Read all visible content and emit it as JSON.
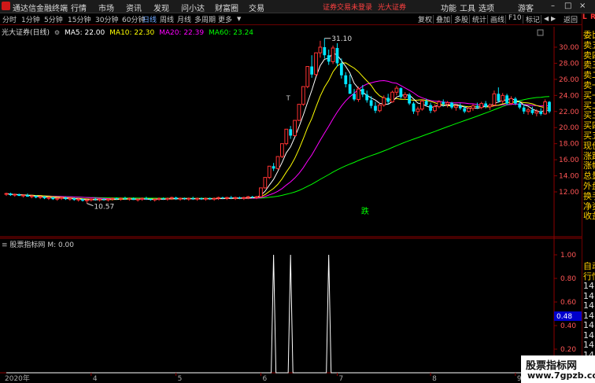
{
  "topbar": {
    "app_title": "通达信金融终端",
    "menu": [
      "行情",
      "市场",
      "资讯",
      "发现",
      "问小达",
      "财富圈",
      "交易"
    ],
    "notice": "证券交易未登录",
    "broker": "光大证券",
    "right_menu": [
      "功能",
      "工具",
      "选项",
      "游客"
    ],
    "window_controls": [
      "–",
      "□",
      "×"
    ]
  },
  "periodbar": {
    "periods": [
      "分时",
      "1分钟",
      "5分钟",
      "15分钟",
      "30分钟",
      "60分钟",
      "日线",
      "周线",
      "月线",
      "多周期",
      "更多"
    ],
    "active": "日线",
    "tools": [
      "复权",
      "叠加",
      "多股",
      "统计",
      "画线",
      "F10",
      "标记",
      "返回"
    ]
  },
  "chart": {
    "security": "光大证券(日线)",
    "ma": [
      {
        "label": "MA5: 22.00",
        "color": "#ffffff"
      },
      {
        "label": "MA10: 22.30",
        "color": "#ffff00"
      },
      {
        "label": "MA20: 22.39",
        "color": "#ff00ff"
      },
      {
        "label": "MA60: 23.24",
        "color": "#00ff00"
      }
    ],
    "y_ticks": [
      "30.00",
      "28.00",
      "26.00",
      "24.00",
      "22.00",
      "20.00",
      "18.00",
      "16.00",
      "14.00",
      "12.00"
    ],
    "high_label": "31.10",
    "low_label": "10.57",
    "t_marker": "T",
    "fall_marker": "跌",
    "sub_title": "股票指标网",
    "sub_value": "M: 0.00",
    "sub_y_ticks": [
      "1.00",
      "0.80",
      "0.60",
      "0.40",
      "0.20"
    ],
    "sub_current": "0.48",
    "x_labels": [
      "2020年",
      "4",
      "5",
      "6",
      "7",
      "8",
      "9"
    ]
  },
  "rightpanel": {
    "top_labels": [
      "L",
      "R"
    ],
    "quote_rows": [
      "委比",
      "卖五",
      "卖四",
      "卖三",
      "卖二",
      "卖一",
      "买一",
      "买二",
      "买三",
      "买四",
      "买五",
      "现价",
      "涨跌",
      "涨幅",
      "总量",
      "外盘",
      "换手",
      "净资",
      "收益"
    ],
    "sub_rows": [
      "自动",
      "行情",
      "14:5",
      "14:5",
      "14:5",
      "14:5",
      "14:5",
      "14:5",
      "14:5",
      "14:5",
      "14:5",
      "14:5"
    ]
  },
  "watermark": {
    "line1": "股票指标网",
    "line2": "www.7gpzb.com"
  },
  "candles": [
    [
      11.7,
      11.9,
      11.5,
      11.8
    ],
    [
      11.8,
      11.9,
      11.5,
      11.6
    ],
    [
      11.6,
      11.8,
      11.4,
      11.7
    ],
    [
      11.7,
      11.8,
      11.5,
      11.5
    ],
    [
      11.5,
      11.7,
      11.3,
      11.6
    ],
    [
      11.6,
      11.8,
      11.4,
      11.4
    ],
    [
      11.4,
      11.6,
      11.2,
      11.5
    ],
    [
      11.5,
      11.6,
      11.2,
      11.3
    ],
    [
      11.3,
      11.5,
      11.1,
      11.4
    ],
    [
      11.4,
      11.5,
      11.1,
      11.2
    ],
    [
      11.2,
      11.4,
      11.0,
      11.3
    ],
    [
      11.3,
      11.4,
      11.0,
      11.1
    ],
    [
      11.1,
      11.3,
      10.9,
      11.2
    ],
    [
      11.2,
      11.4,
      11.0,
      11.3
    ],
    [
      11.3,
      11.4,
      11.0,
      11.1
    ],
    [
      11.1,
      11.3,
      10.9,
      11.2
    ],
    [
      11.2,
      11.3,
      10.9,
      11.0
    ],
    [
      11.0,
      11.2,
      10.8,
      11.1
    ],
    [
      11.1,
      11.2,
      10.8,
      10.9
    ],
    [
      10.9,
      11.1,
      10.57,
      11.0
    ],
    [
      11.0,
      11.2,
      10.8,
      11.1
    ],
    [
      11.1,
      11.3,
      10.9,
      11.0
    ],
    [
      11.0,
      11.2,
      10.8,
      11.1
    ],
    [
      11.1,
      11.2,
      10.9,
      11.0
    ],
    [
      11.0,
      11.2,
      10.8,
      11.1
    ],
    [
      11.1,
      11.3,
      10.9,
      11.2
    ],
    [
      11.2,
      11.3,
      11.0,
      11.1
    ],
    [
      11.1,
      11.3,
      10.9,
      11.2
    ],
    [
      11.2,
      11.4,
      11.0,
      11.1
    ],
    [
      11.1,
      11.3,
      10.9,
      11.2
    ],
    [
      11.2,
      11.3,
      11.0,
      11.0
    ],
    [
      11.0,
      11.2,
      10.8,
      11.1
    ],
    [
      11.1,
      11.3,
      10.9,
      11.2
    ],
    [
      11.2,
      11.4,
      11.0,
      11.1
    ],
    [
      11.1,
      11.2,
      10.9,
      11.0
    ],
    [
      11.0,
      11.2,
      10.8,
      11.1
    ],
    [
      11.1,
      11.3,
      10.9,
      11.2
    ],
    [
      11.2,
      11.3,
      11.0,
      11.1
    ],
    [
      11.1,
      11.3,
      10.9,
      11.2
    ],
    [
      11.2,
      11.4,
      11.0,
      11.3
    ],
    [
      11.3,
      11.4,
      11.0,
      11.1
    ],
    [
      11.1,
      11.3,
      10.9,
      11.2
    ],
    [
      11.2,
      11.3,
      11.0,
      11.1
    ],
    [
      11.1,
      11.3,
      10.9,
      11.2
    ],
    [
      11.2,
      11.4,
      11.0,
      11.1
    ],
    [
      11.1,
      11.3,
      10.9,
      11.2
    ],
    [
      11.2,
      11.3,
      11.0,
      11.1
    ],
    [
      11.1,
      11.3,
      10.9,
      11.2
    ],
    [
      11.2,
      11.3,
      11.0,
      11.1
    ],
    [
      11.1,
      11.3,
      10.9,
      11.2
    ],
    [
      11.2,
      11.4,
      11.0,
      11.3
    ],
    [
      11.3,
      11.4,
      11.1,
      11.2
    ],
    [
      11.2,
      11.4,
      11.0,
      11.3
    ],
    [
      11.3,
      11.5,
      11.1,
      11.2
    ],
    [
      11.2,
      11.4,
      11.0,
      11.3
    ],
    [
      11.3,
      11.4,
      11.1,
      11.2
    ],
    [
      11.2,
      11.4,
      11.0,
      11.3
    ],
    [
      11.3,
      11.5,
      11.1,
      11.4
    ],
    [
      11.4,
      11.5,
      11.2,
      11.3
    ],
    [
      11.3,
      11.5,
      11.1,
      11.4
    ],
    [
      11.4,
      12.5,
      11.4,
      12.5
    ],
    [
      12.5,
      13.8,
      12.4,
      13.8
    ],
    [
      13.8,
      15.2,
      13.6,
      15.2
    ],
    [
      15.2,
      15.6,
      14.6,
      14.9
    ],
    [
      14.9,
      16.4,
      14.8,
      16.4
    ],
    [
      16.4,
      18.0,
      16.2,
      18.0
    ],
    [
      18.0,
      19.8,
      17.8,
      19.8
    ],
    [
      19.8,
      20.2,
      18.6,
      19.0
    ],
    [
      19.0,
      20.9,
      18.9,
      20.9
    ],
    [
      20.9,
      22.9,
      20.8,
      22.9
    ],
    [
      22.9,
      25.1,
      22.7,
      25.1
    ],
    [
      25.1,
      27.6,
      24.9,
      27.6
    ],
    [
      27.6,
      29.0,
      26.2,
      26.6
    ],
    [
      26.6,
      29.3,
      26.4,
      29.3
    ],
    [
      29.3,
      30.8,
      28.7,
      30.0
    ],
    [
      30.0,
      31.1,
      28.6,
      29.0
    ],
    [
      29.0,
      29.7,
      27.8,
      28.2
    ],
    [
      28.2,
      30.2,
      27.9,
      29.9
    ],
    [
      29.9,
      30.5,
      27.6,
      28.0
    ],
    [
      28.0,
      28.6,
      26.1,
      26.5
    ],
    [
      26.5,
      26.9,
      25.0,
      25.4
    ],
    [
      25.4,
      26.6,
      24.6,
      24.2
    ],
    [
      24.2,
      24.8,
      23.3,
      23.5
    ],
    [
      23.5,
      25.1,
      23.2,
      24.8
    ],
    [
      24.8,
      25.3,
      23.8,
      24.1
    ],
    [
      24.1,
      24.6,
      23.1,
      23.4
    ],
    [
      23.4,
      23.9,
      22.4,
      22.7
    ],
    [
      22.7,
      23.2,
      21.8,
      22.1
    ],
    [
      22.1,
      23.0,
      21.9,
      22.8
    ],
    [
      22.8,
      24.0,
      22.6,
      23.7
    ],
    [
      23.7,
      24.2,
      22.9,
      23.2
    ],
    [
      23.2,
      24.6,
      23.1,
      24.4
    ],
    [
      24.4,
      25.2,
      24.0,
      24.9
    ],
    [
      24.9,
      25.0,
      23.6,
      23.8
    ],
    [
      23.8,
      24.4,
      23.5,
      24.1
    ],
    [
      24.1,
      24.3,
      22.8,
      23.0
    ],
    [
      23.0,
      23.2,
      21.7,
      22.0
    ],
    [
      22.0,
      22.6,
      21.5,
      22.3
    ],
    [
      22.3,
      23.5,
      22.1,
      23.3
    ],
    [
      23.3,
      23.6,
      22.6,
      22.8
    ],
    [
      22.8,
      23.1,
      21.8,
      22.1
    ],
    [
      22.1,
      22.9,
      21.9,
      22.6
    ],
    [
      22.6,
      23.4,
      22.4,
      23.2
    ],
    [
      23.2,
      23.5,
      22.6,
      22.9
    ],
    [
      22.9,
      23.3,
      22.5,
      23.1
    ],
    [
      23.1,
      23.2,
      22.3,
      22.5
    ],
    [
      22.5,
      22.9,
      22.1,
      22.7
    ],
    [
      22.7,
      23.0,
      22.2,
      22.4
    ],
    [
      22.4,
      22.7,
      21.8,
      22.0
    ],
    [
      22.0,
      22.6,
      21.9,
      22.4
    ],
    [
      22.4,
      22.9,
      22.1,
      22.7
    ],
    [
      22.7,
      23.1,
      22.3,
      22.5
    ],
    [
      22.5,
      23.2,
      22.3,
      23.0
    ],
    [
      23.0,
      23.3,
      22.4,
      22.6
    ],
    [
      22.6,
      23.0,
      22.2,
      22.8
    ],
    [
      22.8,
      24.6,
      22.7,
      24.2
    ],
    [
      24.2,
      25.0,
      23.1,
      23.3
    ],
    [
      23.3,
      24.3,
      23.0,
      24.0
    ],
    [
      24.0,
      24.2,
      22.8,
      23.0
    ],
    [
      23.0,
      23.9,
      22.8,
      23.6
    ],
    [
      23.6,
      23.8,
      22.8,
      23.0
    ],
    [
      23.0,
      23.3,
      22.3,
      22.5
    ],
    [
      22.5,
      22.9,
      21.7,
      22.0
    ],
    [
      22.0,
      22.5,
      21.6,
      22.2
    ],
    [
      22.2,
      22.6,
      21.6,
      21.8
    ],
    [
      21.8,
      22.3,
      21.4,
      22.0
    ],
    [
      22.0,
      22.4,
      21.5,
      21.7
    ],
    [
      21.7,
      23.5,
      21.6,
      23.2
    ],
    [
      23.2,
      23.3,
      21.8,
      22.0
    ]
  ],
  "signals": [
    {
      "index": 63,
      "value": 1.0
    },
    {
      "index": 67,
      "value": 1.0
    },
    {
      "index": 76,
      "value": 1.0
    }
  ],
  "colors": {
    "up": "#ff3333",
    "down": "#00e5ff",
    "axis_red": "#8b0000",
    "ma5": "#ffffff",
    "ma10": "#ffff00",
    "ma20": "#ff00ff",
    "ma60": "#00ff00"
  }
}
